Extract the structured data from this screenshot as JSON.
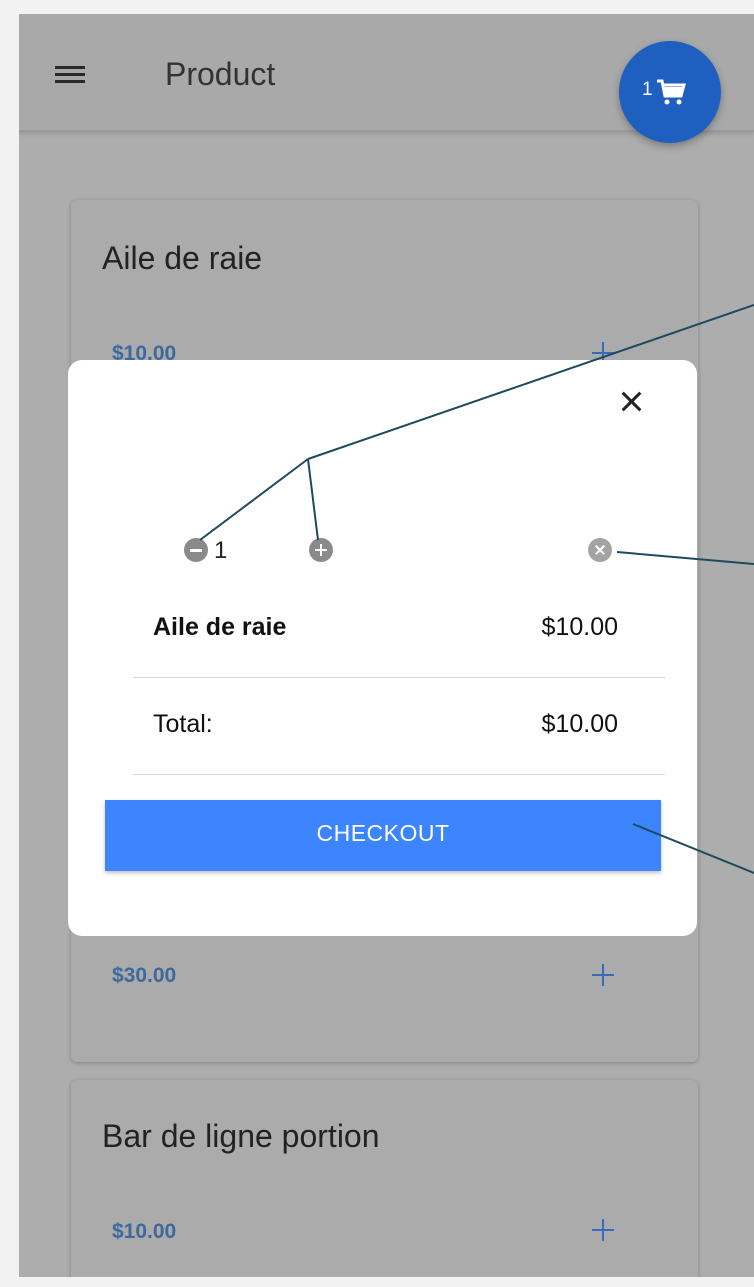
{
  "appbar": {
    "title": "Product"
  },
  "cart": {
    "count": "1"
  },
  "products": [
    {
      "name": "Aile de raie",
      "price": "$10.00"
    },
    {
      "name": "",
      "price": "$30.00"
    },
    {
      "name": "Bar de ligne portion",
      "price": "$10.00"
    }
  ],
  "cart_modal": {
    "item": {
      "quantity": "1",
      "name": "Aile de raie",
      "price": "$10.00"
    },
    "total_label": "Total:",
    "total_value": "$10.00",
    "checkout_label": "CHECKOUT"
  },
  "colors": {
    "fab": "#1f5fbf",
    "checkout_button": "#3d85ff",
    "price_text": "#3d6a9c",
    "callout_lines": "#1d4a5e"
  }
}
